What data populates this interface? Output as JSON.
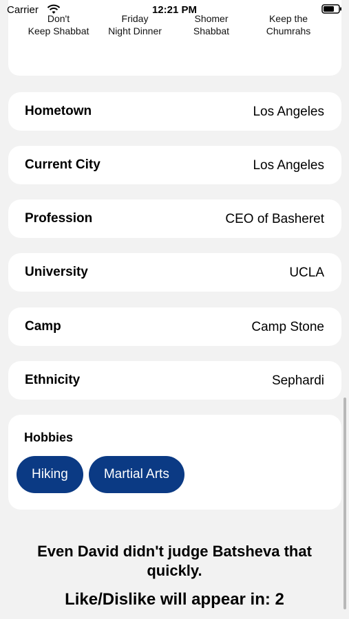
{
  "status_bar": {
    "carrier": "Carrier",
    "time": "12:21 PM"
  },
  "observance": {
    "options": [
      "Don't\nKeep Shabbat",
      "Friday\nNight Dinner",
      "Shomer\nShabbat",
      "Keep the\nChumrahs"
    ]
  },
  "profile": {
    "fields": [
      {
        "label": "Hometown",
        "value": "Los Angeles"
      },
      {
        "label": "Current City",
        "value": "Los Angeles"
      },
      {
        "label": "Profession",
        "value": "CEO of Basheret"
      },
      {
        "label": "University",
        "value": "UCLA"
      },
      {
        "label": "Camp",
        "value": "Camp Stone"
      },
      {
        "label": "Ethnicity",
        "value": "Sephardi"
      }
    ],
    "hobbies_title": "Hobbies",
    "hobbies": [
      "Hiking",
      "Martial Arts"
    ]
  },
  "footer": {
    "quote": "Even David didn't judge Batsheva that quickly.",
    "countdown": "Like/Dislike will appear in: 2"
  },
  "colors": {
    "accent": "#0b3a84",
    "background": "#f2f2f2",
    "card": "#ffffff"
  }
}
